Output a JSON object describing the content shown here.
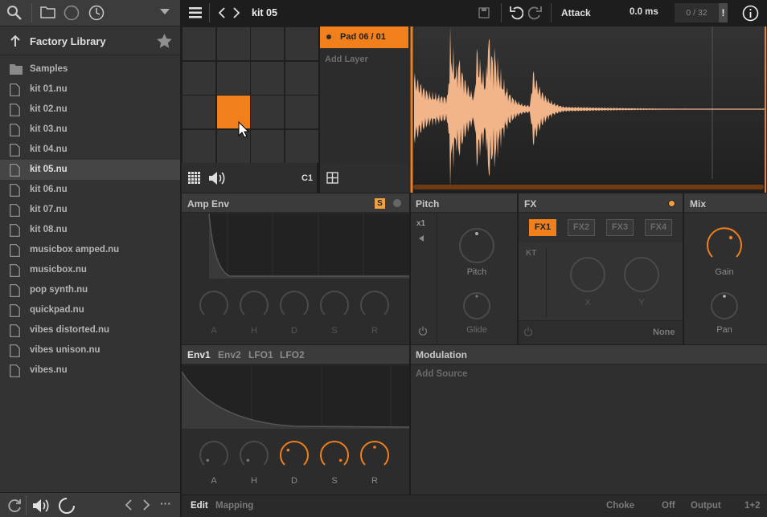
{
  "sidebar": {
    "library_title": "Factory Library",
    "items": [
      {
        "label": "Samples",
        "type": "folder"
      },
      {
        "label": "kit 01.nu",
        "type": "file"
      },
      {
        "label": "kit 02.nu",
        "type": "file"
      },
      {
        "label": "kit 03.nu",
        "type": "file"
      },
      {
        "label": "kit 04.nu",
        "type": "file"
      },
      {
        "label": "kit 05.nu",
        "type": "file",
        "selected": true
      },
      {
        "label": "kit 06.nu",
        "type": "file"
      },
      {
        "label": "kit 07.nu",
        "type": "file"
      },
      {
        "label": "kit 08.nu",
        "type": "file"
      },
      {
        "label": "musicbox amped.nu",
        "type": "file"
      },
      {
        "label": "musicbox.nu",
        "type": "file"
      },
      {
        "label": "pop synth.nu",
        "type": "file"
      },
      {
        "label": "quickpad.nu",
        "type": "file"
      },
      {
        "label": "vibes distorted.nu",
        "type": "file"
      },
      {
        "label": "vibes unison.nu",
        "type": "file"
      },
      {
        "label": "vibes.nu",
        "type": "file"
      }
    ],
    "more_label": "···"
  },
  "topbar": {
    "title": "kit 05",
    "param_name": "Attack",
    "param_value": "0.0 ms",
    "voice_count": "0 / 32",
    "warn_label": "!"
  },
  "pads": {
    "active_index": 9,
    "note": "C1"
  },
  "layers": {
    "selected": "Pad 06 / 01",
    "add_layer": "Add Layer"
  },
  "amp_env": {
    "title": "Amp Env",
    "s_badge": "S",
    "knobs": [
      "A",
      "H",
      "D",
      "S",
      "R"
    ]
  },
  "pitch": {
    "title": "Pitch",
    "multiplier": "x1",
    "pitch_label": "Pitch",
    "glide_label": "Glide"
  },
  "fx": {
    "title": "FX",
    "buttons": [
      "FX1",
      "FX2",
      "FX3",
      "FX4"
    ],
    "active": "FX1",
    "kt_label": "KT",
    "x_label": "X",
    "y_label": "Y",
    "none_label": "None"
  },
  "mix": {
    "title": "Mix",
    "gain_label": "Gain",
    "pan_label": "Pan"
  },
  "env_tabs": {
    "tabs": [
      "Env1",
      "Env2",
      "LFO1",
      "LFO2"
    ],
    "active": "Env1",
    "knobs": [
      "A",
      "H",
      "D",
      "S",
      "R"
    ]
  },
  "modulation": {
    "title": "Modulation",
    "add_source": "Add Source"
  },
  "bottom": {
    "edit": "Edit",
    "mapping": "Mapping",
    "choke_label": "Choke",
    "choke_value": "Off",
    "output_label": "Output",
    "output_value": "1+2"
  },
  "colors": {
    "accent": "#f07f1c",
    "bg": "#2b2b2b",
    "panel": "#3b3b3b",
    "wave": "#f2b58a"
  }
}
